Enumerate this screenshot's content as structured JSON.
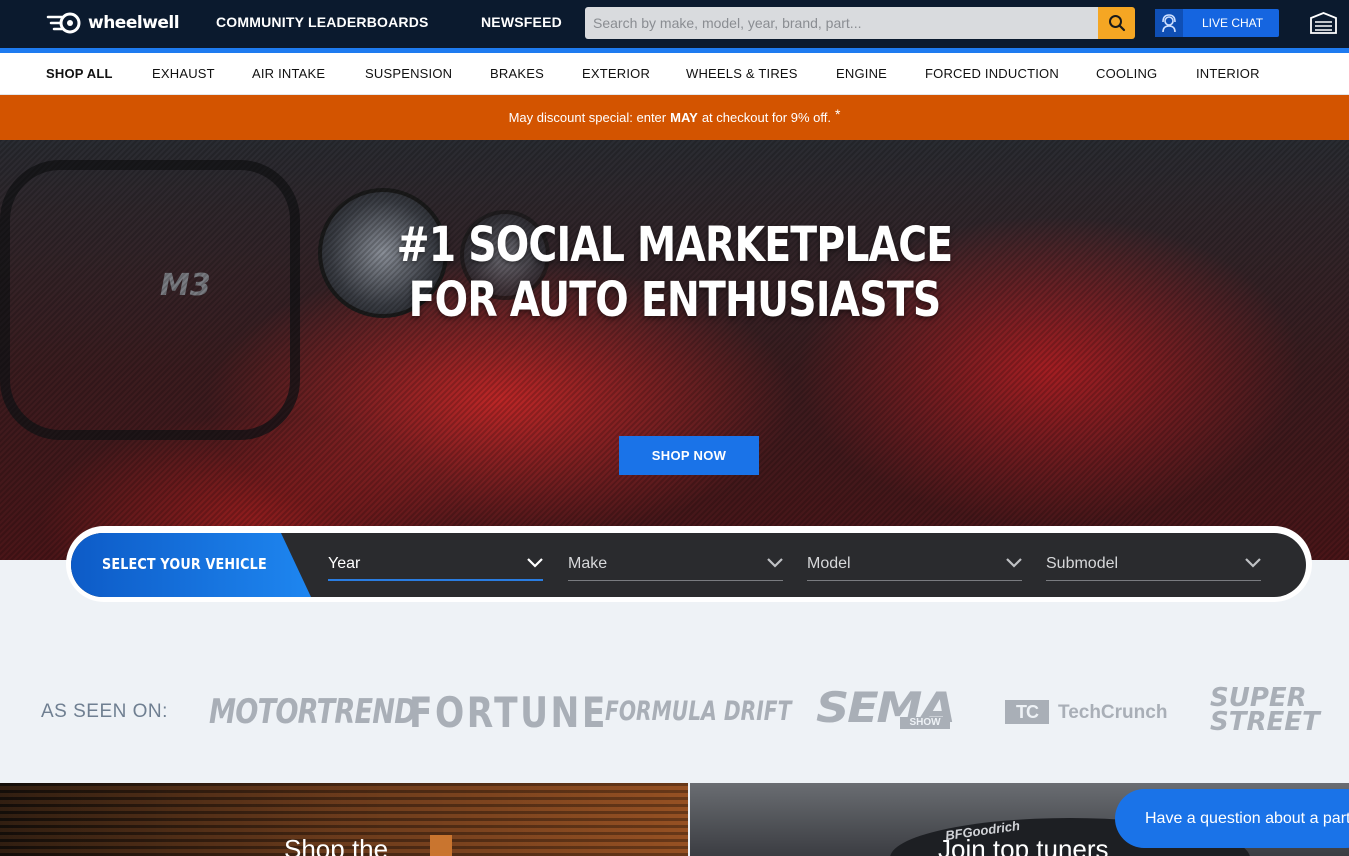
{
  "brand": {
    "name": "wheelwell"
  },
  "topnav": {
    "links": [
      "COMMUNITY LEADERBOARDS",
      "NEWSFEED"
    ],
    "search_placeholder": "Search by make, model, year, brand, part...",
    "live_chat_label": "LIVE CHAT"
  },
  "categories": [
    "SHOP ALL",
    "EXHAUST",
    "AIR INTAKE",
    "SUSPENSION",
    "BRAKES",
    "EXTERIOR",
    "WHEELS & TIRES",
    "ENGINE",
    "FORCED INDUCTION",
    "COOLING",
    "INTERIOR"
  ],
  "promo": {
    "prefix": "May discount special: enter",
    "code": "MAY",
    "suffix": "at checkout for 9% off.",
    "footnote": "*"
  },
  "hero": {
    "title_line1": "#1 SOCIAL MARKETPLACE",
    "title_line2": "FOR AUTO ENTHUSIASTS",
    "cta": "SHOP NOW",
    "badge_text": "M3"
  },
  "vehicle_selector": {
    "label": "SELECT YOUR VEHICLE",
    "dropdowns": [
      "Year",
      "Make",
      "Model",
      "Submodel"
    ]
  },
  "as_seen_on": {
    "label": "AS SEEN ON:",
    "brands": [
      "MOTORTREND",
      "FORTUNE",
      "FORMULA DRIFT",
      "SEMA",
      "TechCrunch",
      "SUPER STREET"
    ],
    "sema_sub": "SHOW",
    "tc_mark": "TC"
  },
  "panels": {
    "left_text": "Shop the",
    "right_text": "Join top tuners",
    "right_decal": "BFGoodrich"
  },
  "chat_bubble": "Have a question about a part",
  "colors": {
    "topbar": "#0b1a2e",
    "accent_blue": "#1a73e8",
    "promo_orange": "#d35400",
    "search_button": "#f5a623"
  }
}
